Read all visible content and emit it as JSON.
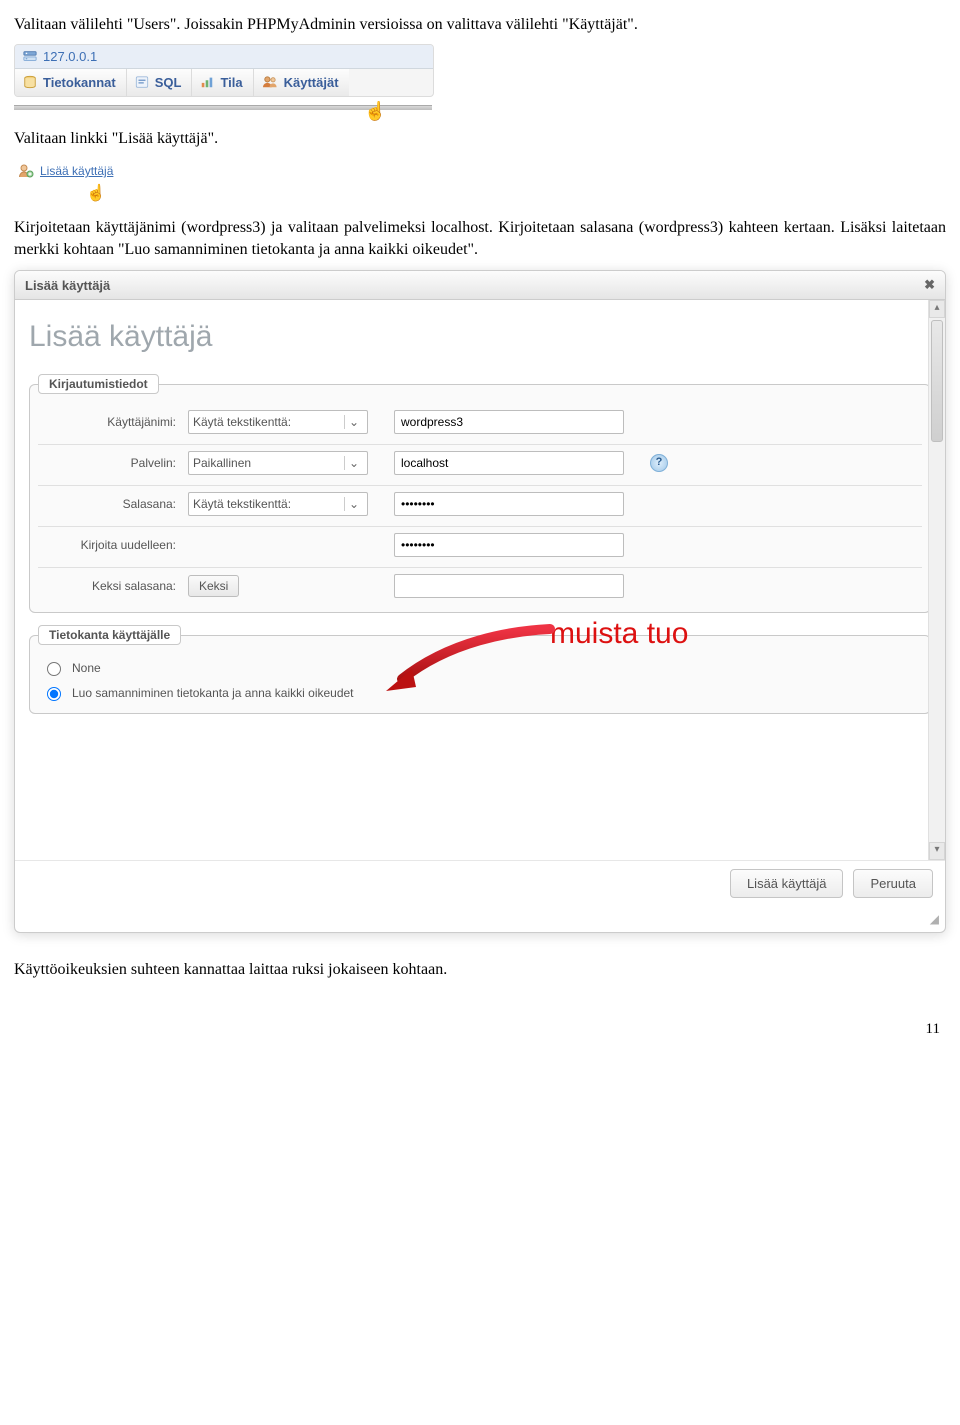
{
  "doc": {
    "p1": "Valitaan välilehti \"Users\". Joissakin PHPMyAdminin versioissa on valittava välilehti \"Käyttäjät\".",
    "p2": "Valitaan linkki \"Lisää käyttäjä\".",
    "p3": "Kirjoitetaan käyttäjänimi (wordpress3) ja valitaan palvelimeksi localhost. Kirjoitetaan salasana (wordpress3) kahteen kertaan. Lisäksi laitetaan merkki kohtaan \"Luo samanniminen tietokanta ja anna kaikki oikeudet\".",
    "p4": "Käyttöoikeuksien suhteen kannattaa laittaa ruksi jokaiseen kohtaan.",
    "page_number": "11"
  },
  "breadcrumb_host": "127.0.0.1",
  "tabs": {
    "databases": "Tietokannat",
    "sql": "SQL",
    "status": "Tila",
    "users": "Käyttäjät"
  },
  "add_link": "Lisää käyttäjä",
  "modal": {
    "title": "Lisää käyttäjä",
    "heading": "Lisää käyttäjä",
    "login_legend": "Kirjautumistiedot",
    "db_legend": "Tietokanta käyttäjälle",
    "labels": {
      "username": "Käyttäjänimi:",
      "host": "Palvelin:",
      "password": "Salasana:",
      "retype": "Kirjoita uudelleen:",
      "generate": "Keksi salasana:"
    },
    "selects": {
      "username_use_text": "Käytä tekstikenttä:",
      "host_local": "Paikallinen",
      "password_use_text": "Käytä tekstikenttä:"
    },
    "values": {
      "username": "wordpress3",
      "host": "localhost",
      "password": "••••••••",
      "retype": "••••••••",
      "generated": ""
    },
    "generate_btn": "Keksi",
    "db": {
      "none": "None",
      "create_same": "Luo samanniminen tietokanta ja anna kaikki oikeudet"
    },
    "footer_ok": "Lisää käyttäjä",
    "footer_cancel": "Peruuta"
  },
  "annotation_text": "muista tuo"
}
